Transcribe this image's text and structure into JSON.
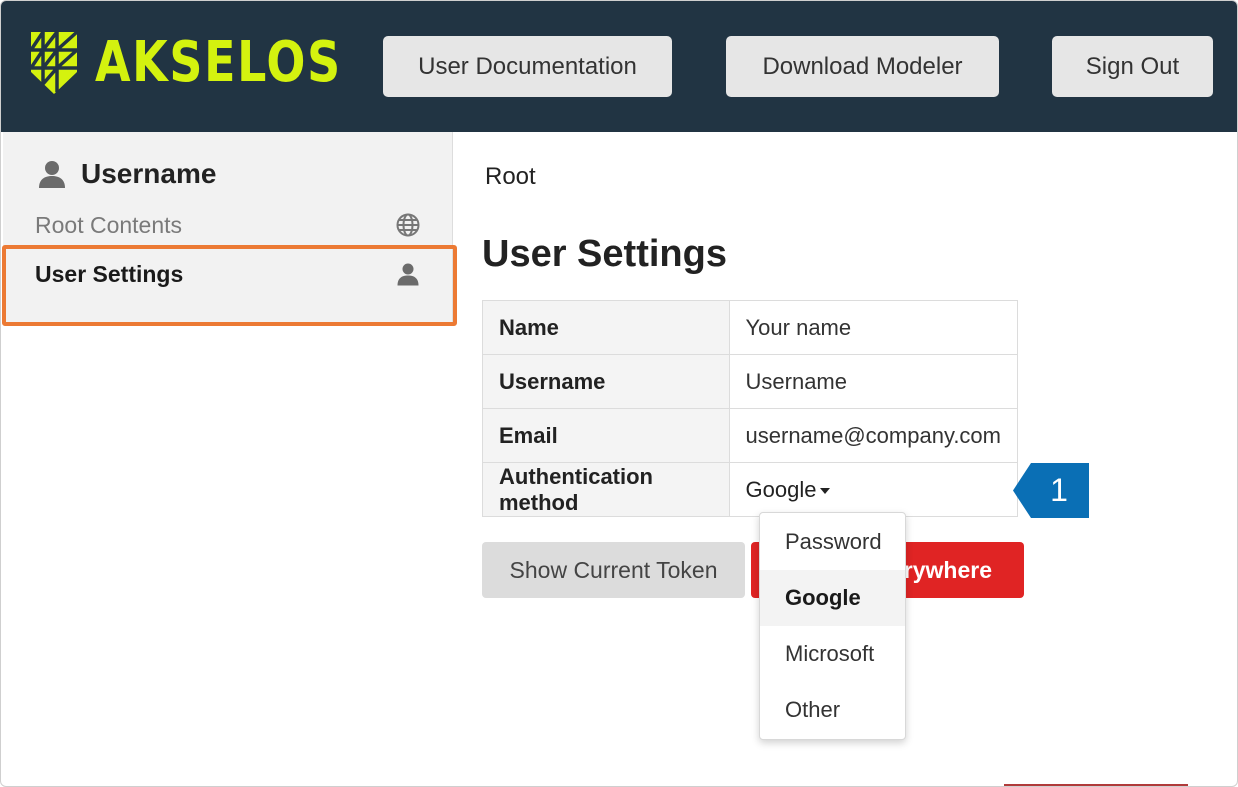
{
  "header": {
    "brand": "AKSELOS",
    "buttons": {
      "user_documentation": "User Documentation",
      "download_modeler": "Download Modeler",
      "sign_out": "Sign Out"
    },
    "colors": {
      "background": "#213443",
      "brand_accent": "#d4f20f"
    }
  },
  "sidebar": {
    "username": "Username",
    "items": [
      {
        "label": "Root Contents",
        "icon": "globe-icon",
        "selected": false
      },
      {
        "label": "User Settings",
        "icon": "user-icon",
        "selected": true
      }
    ],
    "highlight_color": "#ec7a34"
  },
  "main": {
    "breadcrumb": "Root",
    "title": "User Settings",
    "settings": [
      {
        "label": "Name",
        "value": "Your name"
      },
      {
        "label": "Username",
        "value": "Username"
      },
      {
        "label": "Email",
        "value": "username@company.com"
      },
      {
        "label": "Authentication method",
        "value": "Google"
      }
    ],
    "buttons": {
      "show_token": "Show Current Token",
      "sign_out_everywhere_visible": "erywhere"
    },
    "auth_dropdown": {
      "options": [
        "Password",
        "Google",
        "Microsoft",
        "Other"
      ],
      "selected": "Google"
    }
  },
  "callout": {
    "number": "1",
    "color": "#0a6fb5"
  }
}
